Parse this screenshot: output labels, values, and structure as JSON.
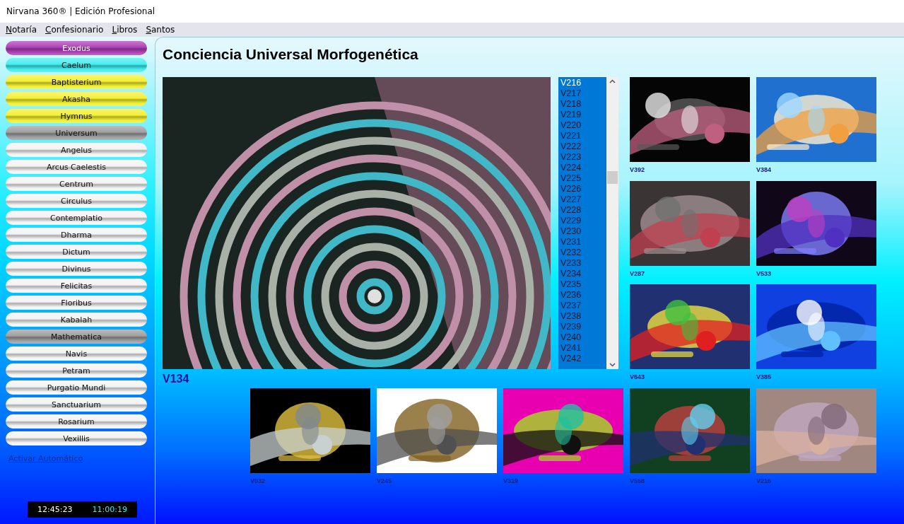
{
  "window": {
    "title": "Nirvana 360® | Edición Profesional"
  },
  "menu": [
    {
      "label": "Notaría"
    },
    {
      "label": "Confesionario"
    },
    {
      "label": "Libros"
    },
    {
      "label": "Santos"
    }
  ],
  "sidebar": {
    "items": [
      {
        "label": "Exodus",
        "color": "#b040b8"
      },
      {
        "label": "Caelum",
        "color": "#40eef0"
      },
      {
        "label": "Baptisterium",
        "color": "#f4f030"
      },
      {
        "label": "Akasha",
        "color": "#f4f030"
      },
      {
        "label": "Hymnus",
        "color": "#f4f030"
      },
      {
        "label": "Universum",
        "color": "#a0a0a0"
      },
      {
        "label": "Angelus",
        "color": "#f4f4f4"
      },
      {
        "label": "Arcus Caelestis",
        "color": "#f4f4f4"
      },
      {
        "label": "Centrum",
        "color": "#f4f4f4"
      },
      {
        "label": "Circulus",
        "color": "#f4f4f4"
      },
      {
        "label": "Contemplatio",
        "color": "#f4f4f4"
      },
      {
        "label": "Dharma",
        "color": "#f4f4f4"
      },
      {
        "label": "Dictum",
        "color": "#f4f4f4"
      },
      {
        "label": "Divinus",
        "color": "#f4f4f4"
      },
      {
        "label": "Felicitas",
        "color": "#f4f4f4"
      },
      {
        "label": "Floribus",
        "color": "#f4f4f4"
      },
      {
        "label": "Kabalah",
        "color": "#f4f4f4"
      },
      {
        "label": "Mathematica",
        "color": "#a0a0a0"
      },
      {
        "label": "Navis",
        "color": "#f4f4f4"
      },
      {
        "label": "Petram",
        "color": "#f4f4f4"
      },
      {
        "label": "Purgatio Mundi",
        "color": "#f4f4f4"
      },
      {
        "label": "Sanctuarium",
        "color": "#f4f4f4"
      },
      {
        "label": "Rosarium",
        "color": "#f4f4f4"
      },
      {
        "label": "Vexillis",
        "color": "#f4f4f4"
      }
    ],
    "link": "Activar Automático",
    "clock": {
      "time": "12:45:23",
      "timer": "11:00:19"
    }
  },
  "main": {
    "title": "Conciencia Universal Morfogenética",
    "featured": {
      "label": "V134"
    },
    "list": {
      "items": [
        {
          "label": "V216",
          "selected": true
        },
        {
          "label": "V217",
          "selected": false
        },
        {
          "label": "V218",
          "selected": false
        },
        {
          "label": "V219",
          "selected": false
        },
        {
          "label": "V220",
          "selected": false
        },
        {
          "label": "V221",
          "selected": false
        },
        {
          "label": "V222",
          "selected": false
        },
        {
          "label": "V223",
          "selected": false
        },
        {
          "label": "V224",
          "selected": false
        },
        {
          "label": "V225",
          "selected": false
        },
        {
          "label": "V226",
          "selected": false
        },
        {
          "label": "V227",
          "selected": false
        },
        {
          "label": "V228",
          "selected": false
        },
        {
          "label": "V229",
          "selected": false
        },
        {
          "label": "V230",
          "selected": false
        },
        {
          "label": "V231",
          "selected": false
        },
        {
          "label": "V232",
          "selected": false
        },
        {
          "label": "V233",
          "selected": false
        },
        {
          "label": "V234",
          "selected": false
        },
        {
          "label": "V235",
          "selected": false
        },
        {
          "label": "V236",
          "selected": false
        },
        {
          "label": "V237",
          "selected": false
        },
        {
          "label": "V238",
          "selected": false
        },
        {
          "label": "V239",
          "selected": false
        },
        {
          "label": "V240",
          "selected": false
        },
        {
          "label": "V241",
          "selected": false
        },
        {
          "label": "V242",
          "selected": false
        }
      ]
    },
    "side_thumbnails": [
      {
        "label": "V392"
      },
      {
        "label": "V384"
      },
      {
        "label": "V287"
      },
      {
        "label": "V533"
      },
      {
        "label": "V643"
      },
      {
        "label": "V385"
      }
    ],
    "bottom_thumbnails": [
      {
        "label": "V032"
      },
      {
        "label": "V245"
      },
      {
        "label": "V319"
      },
      {
        "label": "V558"
      },
      {
        "label": "V216"
      }
    ]
  }
}
